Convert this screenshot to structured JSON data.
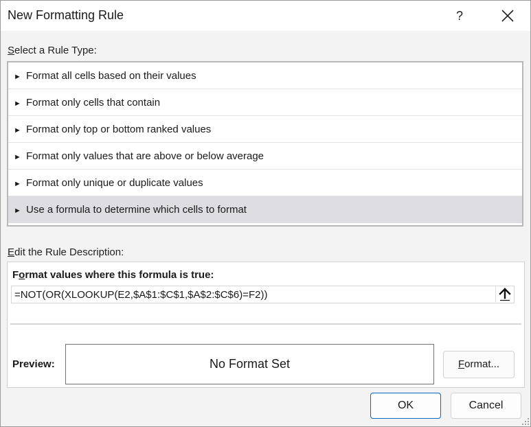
{
  "window": {
    "title": "New Formatting Rule",
    "help_label": "?"
  },
  "rule_type": {
    "section_label_u": "S",
    "section_label_rest": "elect a Rule Type:",
    "items": [
      {
        "label": "Format all cells based on their values"
      },
      {
        "label": "Format only cells that contain"
      },
      {
        "label": "Format only top or bottom ranked values"
      },
      {
        "label": "Format only values that are above or below average"
      },
      {
        "label": "Format only unique or duplicate values"
      },
      {
        "label": "Use a formula to determine which cells to format"
      }
    ],
    "selected_index": 5,
    "bullet": "►"
  },
  "description": {
    "section_label_u": "E",
    "section_label_rest": "dit the Rule Description:",
    "formula_caption_pre": "F",
    "formula_caption_u": "o",
    "formula_caption_rest": "rmat values where this formula is true:",
    "formula_value": "=NOT(OR(XLOOKUP(E2,$A$1:$C$1,$A$2:$C$6)=F2))",
    "collapse_icon": "collapse-arrow-up-icon",
    "preview_label": "Preview:",
    "preview_text": "No Format Set",
    "format_button_u": "F",
    "format_button_rest": "ormat..."
  },
  "buttons": {
    "ok": "OK",
    "cancel": "Cancel"
  },
  "colors": {
    "selected_row": "#dddde2",
    "default_button_border": "#0067c0"
  }
}
